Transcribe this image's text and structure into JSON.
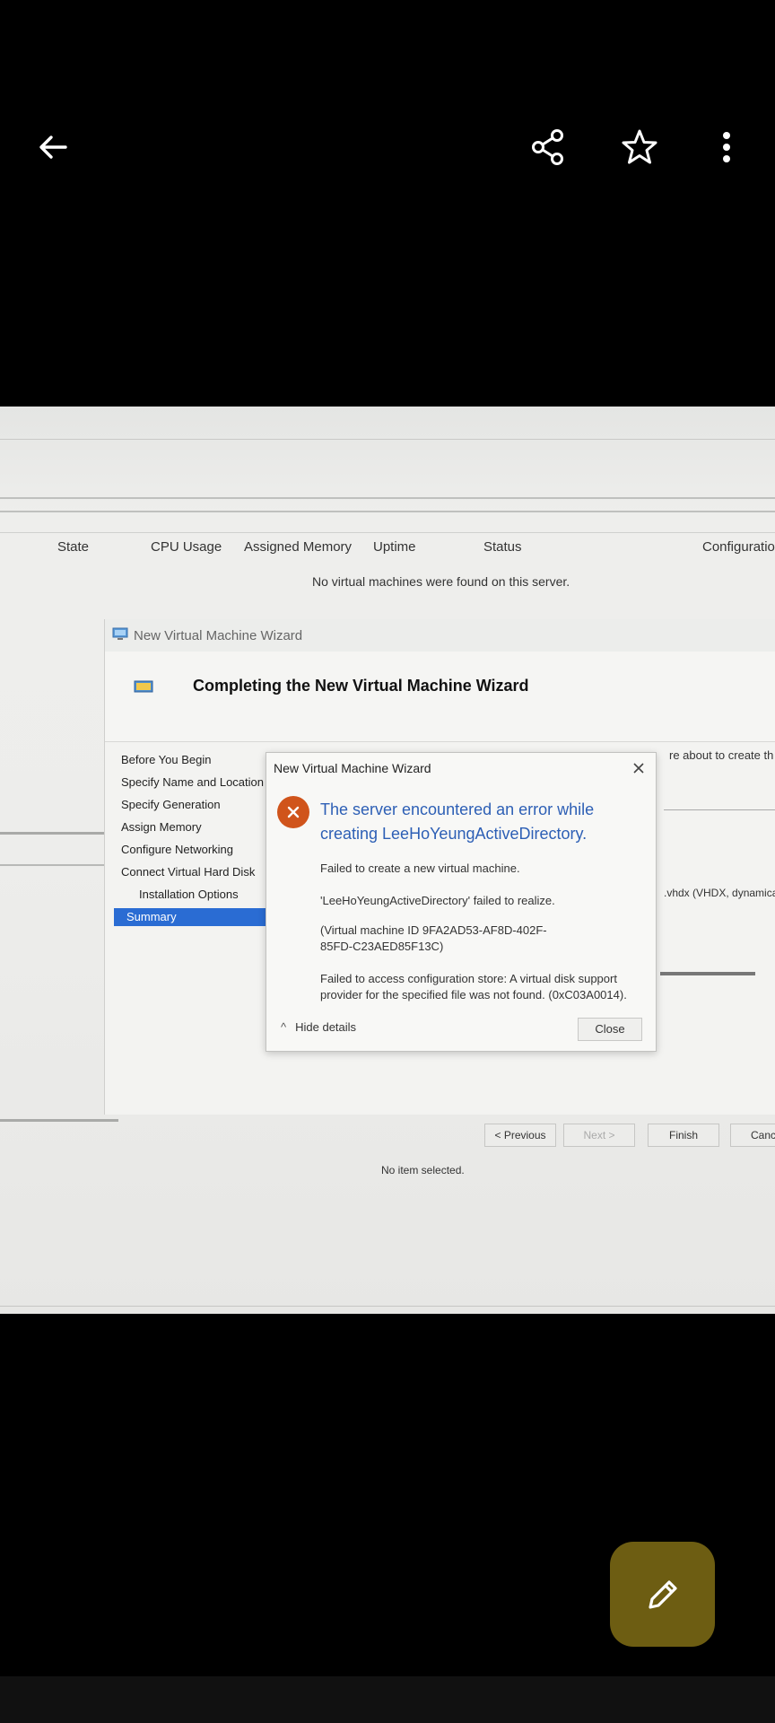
{
  "viewer": {
    "back_icon": "arrow-left-icon",
    "share_icon": "share-icon",
    "favorite_icon": "star-outline-icon",
    "more_icon": "more-vertical-icon",
    "edit_icon": "pencil-icon",
    "fab_color": "#6d5d12"
  },
  "photo": {
    "columns": [
      "State",
      "CPU Usage",
      "Assigned Memory",
      "Uptime",
      "Status",
      "Configuratio"
    ],
    "empty_message": "No virtual machines were found on this server.",
    "status_bar": "No item selected.",
    "wizard": {
      "window_title": "New Virtual Machine Wizard",
      "heading": "Completing the New Virtual Machine Wizard",
      "nav": [
        "Before You Begin",
        "Specify Name and Location",
        "Specify Generation",
        "Assign Memory",
        "Configure Networking",
        "Connect Virtual Hard Disk",
        "Installation Options",
        "Summary"
      ],
      "right_text_1": "re about to create th",
      "right_text_2": ".vhdx (VHDX, dynamica",
      "buttons": {
        "previous": "< Previous",
        "next": "Next >",
        "finish": "Finish",
        "cancel": "Canc"
      },
      "active_color": "#2a6cd3"
    },
    "error_dialog": {
      "title": "New Virtual Machine Wizard",
      "heading": "The server encountered an error while creating LeeHoYeungActiveDirectory.",
      "line1": "Failed to create a new virtual machine.",
      "line2": "'LeeHoYeungActiveDirectory' failed to realize.",
      "line3": "(Virtual machine ID 9FA2AD53-AF8D-402F-85FD-C23AED85F13C)",
      "line4": "Failed to access configuration store: A virtual disk support provider for the specified file was not found. (0xC03A0014).",
      "hide_details": "Hide details",
      "close": "Close",
      "heading_color": "#2d5fb5",
      "error_color": "#d0541b"
    }
  }
}
